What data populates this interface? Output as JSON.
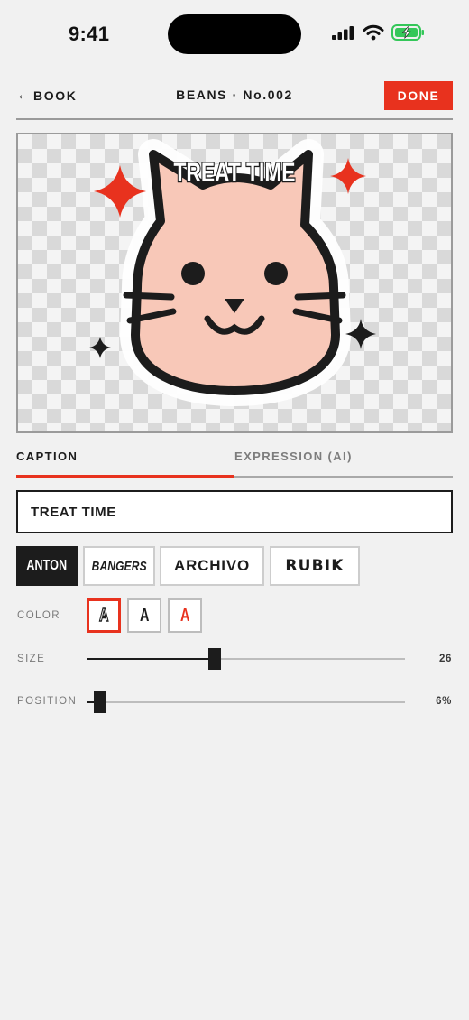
{
  "status_bar": {
    "time": "9:41",
    "icons": [
      "cellular-signal-icon",
      "wifi-icon",
      "battery-charging-icon"
    ]
  },
  "nav": {
    "back_label": "BOOK",
    "back_icon": "left-arrow-icon",
    "title": "BEANS · No.002",
    "done_label": "DONE"
  },
  "canvas": {
    "caption_text": "TREAT TIME",
    "sticker": "cat-face-sticker",
    "decorations": [
      "red-sparkle-icon",
      "red-sparkle-icon",
      "black-sparkle-icon",
      "black-sparkle-icon"
    ]
  },
  "tabs": [
    {
      "label": "CAPTION",
      "active": true
    },
    {
      "label": "EXPRESSION (AI)",
      "active": false
    }
  ],
  "caption_input": {
    "value": "TREAT TIME"
  },
  "fonts": [
    {
      "label": "ANTON",
      "selected": true
    },
    {
      "label": "BANGERS",
      "selected": false
    },
    {
      "label": "ARCHIVO",
      "selected": false
    },
    {
      "label": "RUBIK",
      "selected": false
    }
  ],
  "color": {
    "label": "COLOR",
    "swatches": [
      {
        "glyph": "A",
        "style": "outline",
        "selected": true
      },
      {
        "glyph": "A",
        "style": "black",
        "selected": false
      },
      {
        "glyph": "A",
        "style": "red",
        "selected": false
      }
    ]
  },
  "size": {
    "label": "SIZE",
    "value": 26,
    "display": "26",
    "fraction": 0.4
  },
  "position": {
    "label": "POSITION",
    "value": 6,
    "display": "6%",
    "fraction": 0.04
  },
  "colors": {
    "accent": "#e8321e",
    "ink": "#1c1c1c",
    "cat_face": "#f8c8b8",
    "background": "#f1f1f1"
  }
}
